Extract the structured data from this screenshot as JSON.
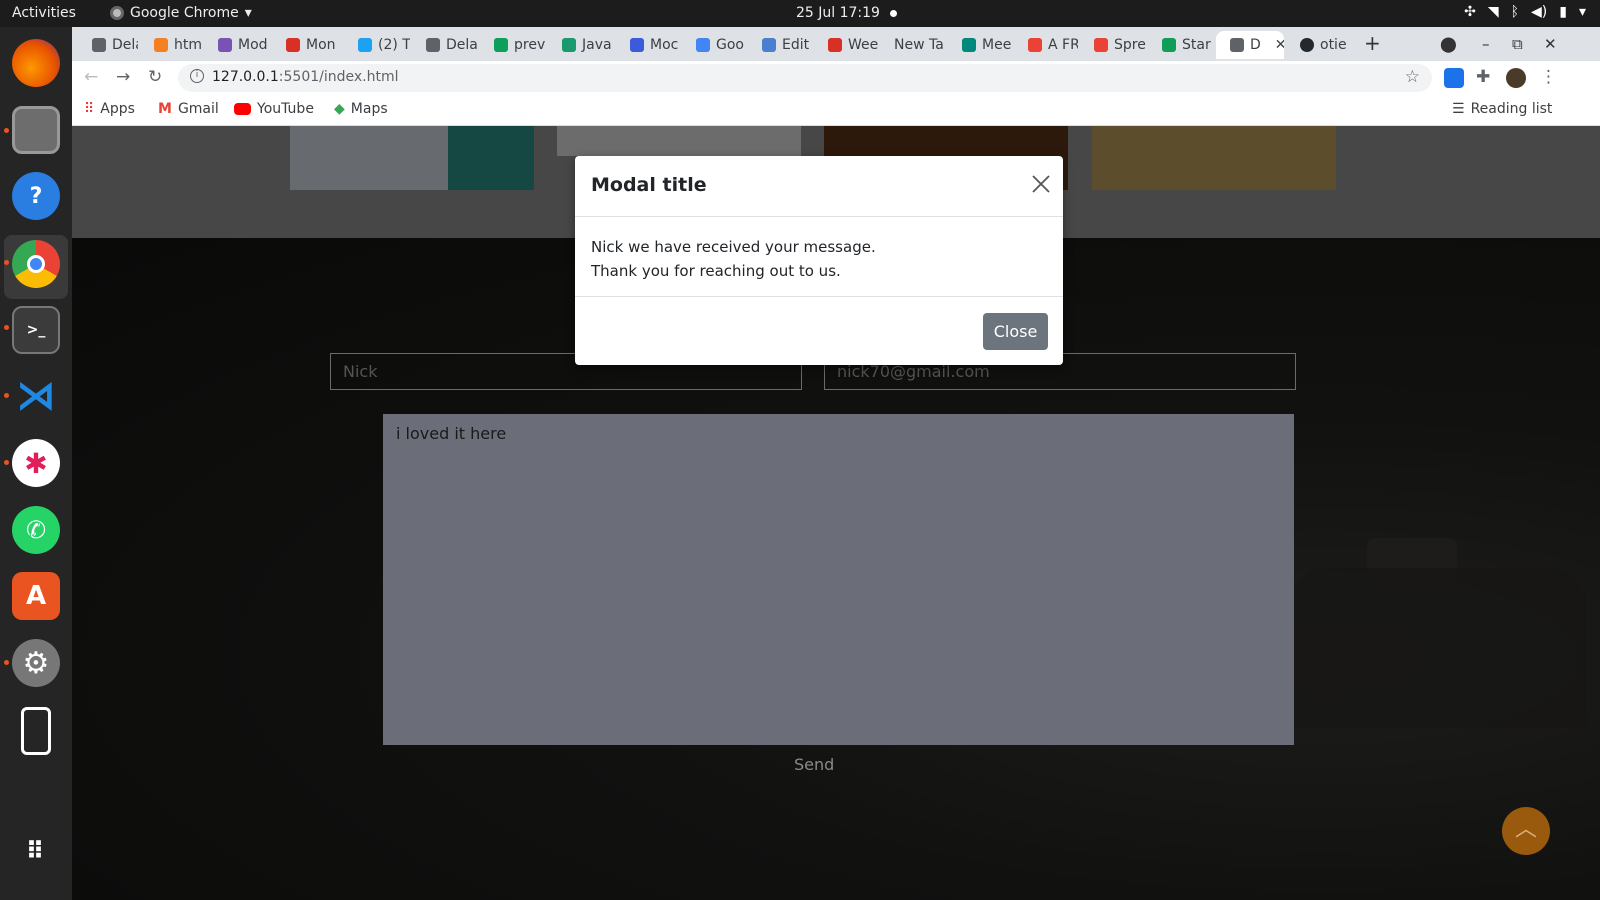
{
  "system": {
    "activities": "Activities",
    "app_name": "Google Chrome",
    "clock": "25 Jul  17:19"
  },
  "chrome": {
    "tabs": [
      {
        "label": "Dela",
        "color": "#5f6368"
      },
      {
        "label": "htm",
        "color": "#f48024"
      },
      {
        "label": "Mod",
        "color": "#7952b3"
      },
      {
        "label": "Mon",
        "color": "#d93025"
      },
      {
        "label": "(2) T",
        "color": "#1da1f2"
      },
      {
        "label": "Dela",
        "color": "#5f6368"
      },
      {
        "label": "prev",
        "color": "#0c9e5a"
      },
      {
        "label": "Java",
        "color": "#1a9a6c"
      },
      {
        "label": "Moc",
        "color": "#3b5bdb"
      },
      {
        "label": "Goo",
        "color": "#4285f4"
      },
      {
        "label": "Edit",
        "color": "#4a7fd0"
      },
      {
        "label": "Wee",
        "color": "#d93025"
      },
      {
        "label": "New Ta",
        "color": ""
      },
      {
        "label": "Mee",
        "color": "#00897b"
      },
      {
        "label": "A FR",
        "color": "#ea4335"
      },
      {
        "label": "Spre",
        "color": "#ea4335"
      },
      {
        "label": "Star",
        "color": "#0f9d58"
      },
      {
        "label": "D",
        "color": "#5f6368"
      },
      {
        "label": "otie",
        "color": "#24292e"
      }
    ],
    "url_host": "127.0.0.1",
    "url_rest": ":5501/index.html",
    "bookmarks": [
      {
        "label": "Apps",
        "color": "#e53935"
      },
      {
        "label": "Gmail",
        "color": "#ea4335"
      },
      {
        "label": "YouTube",
        "color": "#ff0000"
      },
      {
        "label": "Maps",
        "color": "#34a853"
      }
    ],
    "reading_list": "Reading list"
  },
  "page": {
    "name_value": "Nick",
    "email_value": "nick70@gmail.com",
    "message_value": "i loved it here",
    "send_label": "Send",
    "back_to_top_icon": "chevron-up-icon"
  },
  "modal": {
    "title": "Modal title",
    "line1": "Nick we have received your message.",
    "line2": "Thank you for reaching out to us.",
    "close_label": "Close"
  }
}
